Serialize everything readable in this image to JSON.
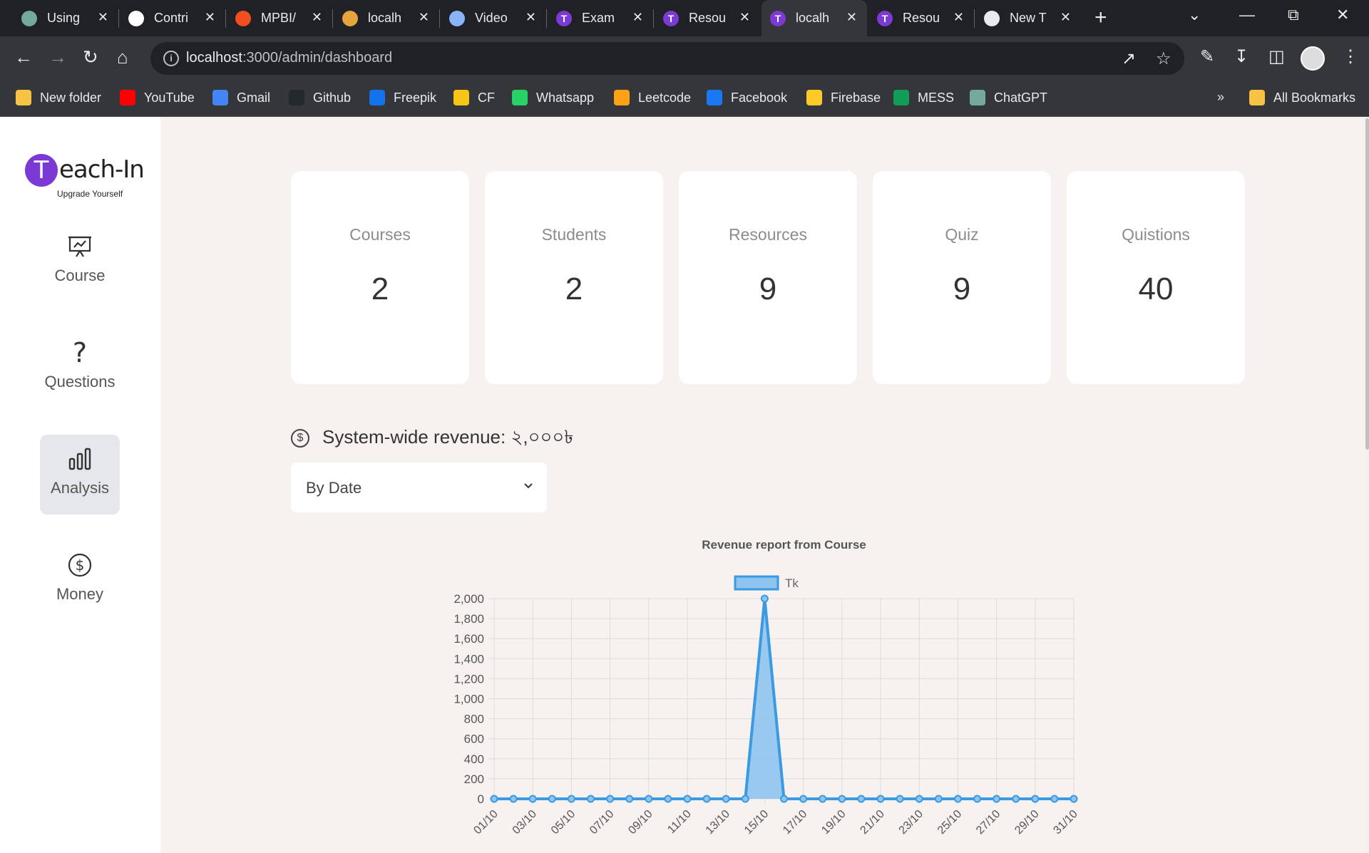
{
  "browser": {
    "tabs": [
      {
        "title": "Using",
        "icon": "chatgpt-icon",
        "color": "#74aa9c"
      },
      {
        "title": "Contri",
        "icon": "github-icon",
        "color": "#ffffff"
      },
      {
        "title": "MPBI/",
        "icon": "figma-icon",
        "color": "#f24e1e"
      },
      {
        "title": "localh",
        "icon": "mountain-icon",
        "color": "#e8a33c"
      },
      {
        "title": "Video",
        "icon": "video-icon",
        "color": "#8ab4f8"
      },
      {
        "title": "Exam",
        "icon": "teachin-icon",
        "color": "#7c3ad5"
      },
      {
        "title": "Resou",
        "icon": "teachin-icon",
        "color": "#7c3ad5"
      },
      {
        "title": "localh",
        "icon": "teachin-icon",
        "color": "#7c3ad5"
      },
      {
        "title": "Resou",
        "icon": "teachin-icon",
        "color": "#7c3ad5"
      },
      {
        "title": "New T",
        "icon": "chrome-icon",
        "color": "#e8eaed"
      }
    ],
    "active_tab_index": 7,
    "url_host": "localhost",
    "url_path": ":3000/admin/dashboard",
    "bookmarks": [
      {
        "label": "New folder",
        "icon": "folder-icon",
        "color": "#f6c344"
      },
      {
        "label": "YouTube",
        "icon": "youtube-icon",
        "color": "#ff0000"
      },
      {
        "label": "Gmail",
        "icon": "docs-icon",
        "color": "#4285f4"
      },
      {
        "label": "Github",
        "icon": "github-icon",
        "color": "#24292e"
      },
      {
        "label": "Freepik",
        "icon": "freepik-icon",
        "color": "#1273eb"
      },
      {
        "label": "CF",
        "icon": "codeforces-icon",
        "color": "#f5c518"
      },
      {
        "label": "Whatsapp",
        "icon": "whatsapp-icon",
        "color": "#25d366"
      },
      {
        "label": "Leetcode",
        "icon": "leetcode-icon",
        "color": "#ffa116"
      },
      {
        "label": "Facebook",
        "icon": "facebook-icon",
        "color": "#1877f2"
      },
      {
        "label": "Firebase",
        "icon": "firebase-icon",
        "color": "#ffca28"
      },
      {
        "label": "MESS",
        "icon": "sheets-icon",
        "color": "#0f9d58"
      },
      {
        "label": "ChatGPT",
        "icon": "chatgpt-icon",
        "color": "#74aa9c"
      }
    ],
    "bookmarks_overflow": "»",
    "all_bookmarks": "All Bookmarks"
  },
  "app": {
    "logo_letter": "T",
    "logo_text": "each-In",
    "logo_tagline": "Upgrade Yourself",
    "brand_color": "#7c3ad5",
    "nav": [
      {
        "label": "Course",
        "icon": "presentation-icon"
      },
      {
        "label": "Questions",
        "icon": "question-icon"
      },
      {
        "label": "Analysis",
        "icon": "bar-chart-icon"
      },
      {
        "label": "Money",
        "icon": "dollar-icon"
      }
    ],
    "active_nav": "Analysis"
  },
  "stats": [
    {
      "label": "Courses",
      "value": "2"
    },
    {
      "label": "Students",
      "value": "2"
    },
    {
      "label": "Resources",
      "value": "9"
    },
    {
      "label": "Quiz",
      "value": "9"
    },
    {
      "label": "Quistions",
      "value": "40"
    }
  ],
  "revenue": {
    "label": "System-wide revenue: ২,০০০৳",
    "icon": "dollar-icon"
  },
  "filter": {
    "selected": "By Date"
  },
  "chart_data": {
    "type": "line",
    "title": "Revenue report from Course",
    "legend_placement": "top",
    "grid": true,
    "ylim": [
      0,
      2000
    ],
    "y_ticks": [
      "0",
      "200",
      "400",
      "600",
      "800",
      "1,000",
      "1,200",
      "1,400",
      "1,600",
      "1,800",
      "2,000"
    ],
    "x": [
      "01/10",
      "02/10",
      "03/10",
      "04/10",
      "05/10",
      "06/10",
      "07/10",
      "08/10",
      "09/10",
      "10/10",
      "11/10",
      "12/10",
      "13/10",
      "14/10",
      "15/10",
      "16/10",
      "17/10",
      "18/10",
      "19/10",
      "20/10",
      "21/10",
      "22/10",
      "23/10",
      "24/10",
      "25/10",
      "26/10",
      "27/10",
      "28/10",
      "29/10",
      "30/10",
      "31/10"
    ],
    "x_tick_labels": [
      "01/10",
      "03/10",
      "05/10",
      "07/10",
      "09/10",
      "11/10",
      "13/10",
      "15/10",
      "17/10",
      "19/10",
      "21/10",
      "23/10",
      "25/10",
      "27/10",
      "29/10",
      "31/10"
    ],
    "series": [
      {
        "name": "Tk",
        "color": "#3b9ae1",
        "fill": "#8ec4ee",
        "values": [
          0,
          0,
          0,
          0,
          0,
          0,
          0,
          0,
          0,
          0,
          0,
          0,
          0,
          0,
          2000,
          0,
          0,
          0,
          0,
          0,
          0,
          0,
          0,
          0,
          0,
          0,
          0,
          0,
          0,
          0,
          0
        ]
      }
    ]
  }
}
